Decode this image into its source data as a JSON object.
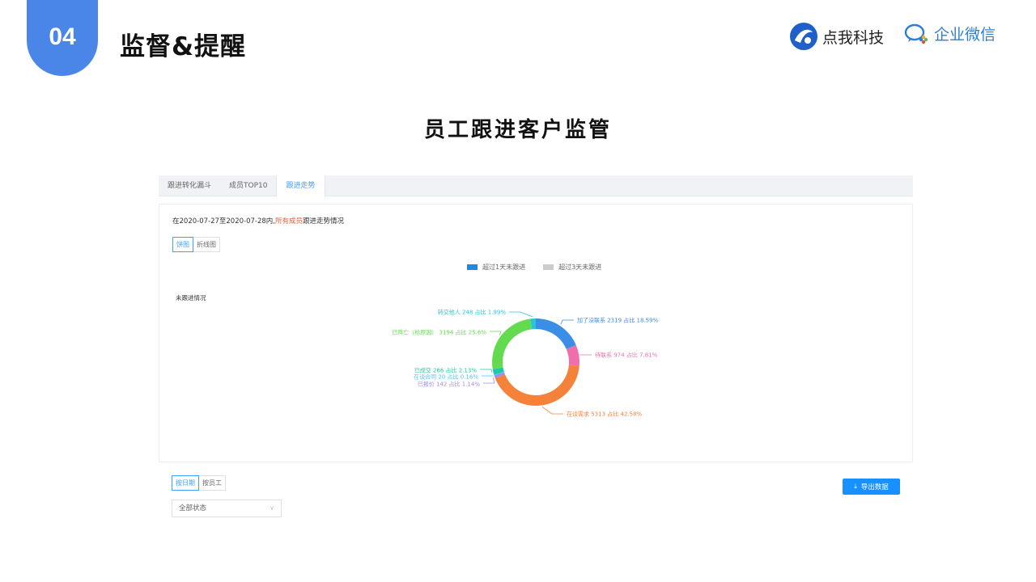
{
  "slide": {
    "number": "04",
    "title": "监督&提醒",
    "heading": "员工跟进客户监管"
  },
  "brands": {
    "brand1": {
      "name": "点我科技",
      "icon": "dianwo-logo-icon",
      "color": "#1f5fc9"
    },
    "brand2": {
      "name": "企业微信",
      "icon": "wecom-logo-icon",
      "color": "#2a7fd4"
    }
  },
  "tabs": [
    {
      "label": "跟进转化漏斗",
      "active": false
    },
    {
      "label": "成员TOP10",
      "active": false
    },
    {
      "label": "跟进走势",
      "active": true
    }
  ],
  "summary": {
    "prefix": "在2020-07-27至2020-07-28内,",
    "highlight": "所有成员",
    "suffix": "跟进走势情况"
  },
  "chart_toggle": {
    "pie": "饼图",
    "line": "折线图",
    "selected": "饼图"
  },
  "legend": [
    {
      "label": "超过1天未跟进",
      "color": "#1e88e5"
    },
    {
      "label": "超过3天未跟进",
      "color": "#cccccc"
    }
  ],
  "chart_section_label": "未跟进情况",
  "chart_data": {
    "type": "pie",
    "donut": true,
    "title": "未跟进情况",
    "slices": [
      {
        "label": "加了没联系 2319 占比 18.59%",
        "value": 2319,
        "color": "#3a8ee6"
      },
      {
        "label": "待联系 974 占比 7.81%",
        "value": 974,
        "color": "#ef6fac"
      },
      {
        "label": "在谈需求 5313 占比 42.58%",
        "value": 5313,
        "color": "#f5823a"
      },
      {
        "label": "已报价 142 占比 1.14%",
        "value": 142,
        "color": "#9b8ef0"
      },
      {
        "label": "在谈合同 20 占比 0.16%",
        "value": 20,
        "color": "#4fc3f7"
      },
      {
        "label": "已成交 266 占比 2.13%",
        "value": 266,
        "color": "#1ec9a6"
      },
      {
        "label": "已阵亡（标原因） 3194 占比 25.6%",
        "value": 3194,
        "color": "#64db4f"
      },
      {
        "label": "转交他人 248 占比 1.99%",
        "value": 248,
        "color": "#26c6da"
      }
    ]
  },
  "view_toggle": {
    "by_date": "按日期",
    "by_staff": "按员工",
    "selected": "按日期"
  },
  "status_filter": {
    "value": "全部状态"
  },
  "export_button": {
    "label": "导出数据"
  }
}
